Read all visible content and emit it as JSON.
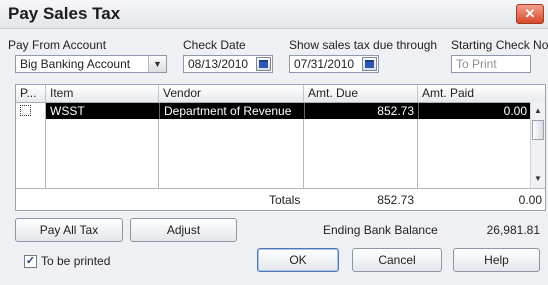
{
  "window": {
    "title": "Pay Sales Tax",
    "close_glyph": "✕"
  },
  "form": {
    "pay_from_account_label": "Pay From Account",
    "pay_from_account_value": "Big Banking Account",
    "check_date_label": "Check Date",
    "check_date_value": "08/13/2010",
    "show_through_label": "Show sales tax due through",
    "show_through_value": "07/31/2010",
    "starting_check_label": "Starting Check No.",
    "starting_check_value": "To Print"
  },
  "table": {
    "headers": [
      "P...",
      "Item",
      "Vendor",
      "Amt. Due",
      "Amt. Paid"
    ],
    "rows": [
      {
        "pay": "",
        "item": "WSST",
        "vendor": "Department of Revenue",
        "amt_due": "852.73",
        "amt_paid": "0.00"
      }
    ],
    "totals_label": "Totals",
    "totals_due": "852.73",
    "totals_paid": "0.00"
  },
  "actions": {
    "pay_all_tax": "Pay All Tax",
    "adjust": "Adjust",
    "ending_bank_balance_label": "Ending Bank Balance",
    "ending_bank_balance_value": "26,981.81"
  },
  "footer": {
    "to_be_printed_label": "To be printed",
    "to_be_printed_checked": true,
    "ok": "OK",
    "cancel": "Cancel",
    "help": "Help"
  },
  "icons": {
    "dropdown": "chevron-down-icon",
    "calendar": "calendar-icon",
    "close": "close-icon"
  },
  "colors": {
    "selection": "#000000",
    "close_button": "#d6482b"
  }
}
